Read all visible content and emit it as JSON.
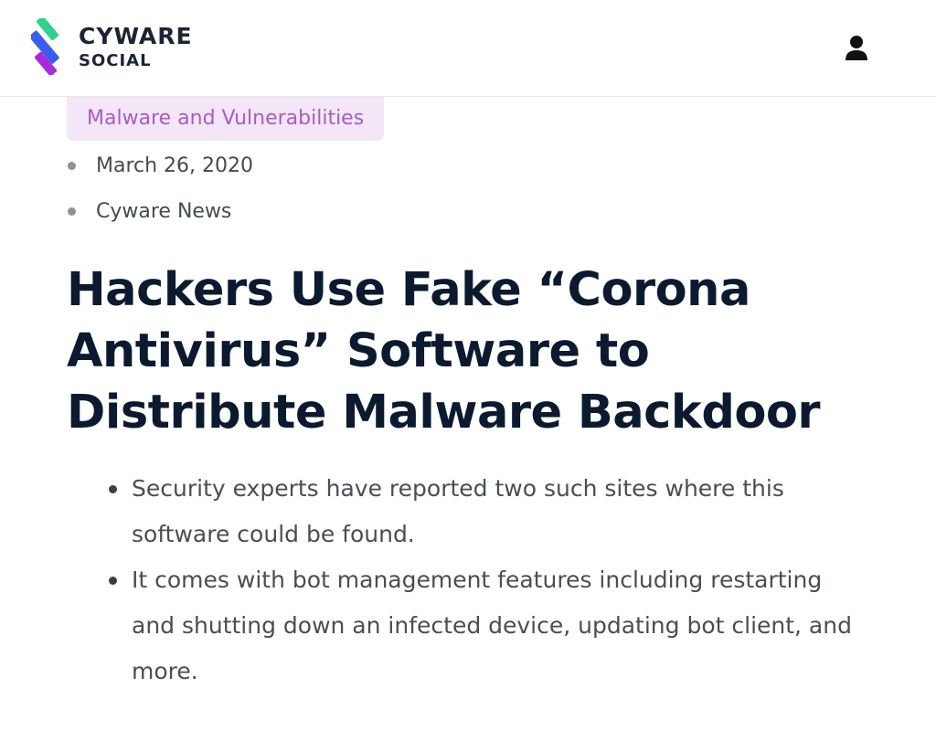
{
  "header": {
    "brand": "CYWARE",
    "brand_sub": "SOCIAL",
    "user_icon": "user-icon"
  },
  "article": {
    "category": "Malware and Vulnerabilities",
    "meta": [
      {
        "text": "March 26, 2020"
      },
      {
        "text": "Cyware News"
      }
    ],
    "title": "Hackers Use Fake “Corona Antivirus” Software to Distribute Malware Backdoor",
    "summary": [
      "Security experts have reported two such sites where this software could be found.",
      "It comes with bot management features including restarting and shutting down an infected device, updating bot client, and more."
    ]
  },
  "colors": {
    "logo_green": "#2fd18c",
    "logo_blue": "#3b5cf0",
    "logo_purple": "#a82bd9",
    "category_bg": "#f3e6f6",
    "category_text": "#a95cc8",
    "title": "#0c1a30"
  }
}
